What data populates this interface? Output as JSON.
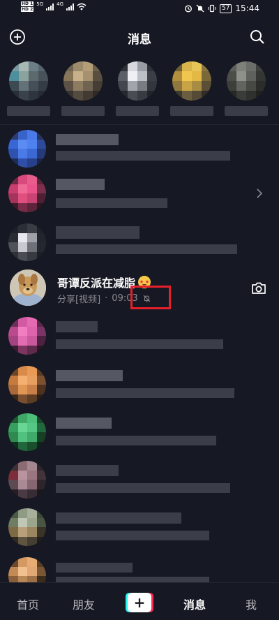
{
  "status_bar": {
    "hd1": "HD 1",
    "hd2": "HD 2",
    "net1": "5G",
    "net2": "4G",
    "battery": "57",
    "time": "15:44"
  },
  "header": {
    "title": "消息",
    "left_icon": "add-circle-icon",
    "right_icon": "search-icon"
  },
  "conversation": {
    "name": "哥谭反派在减脂",
    "emoji": "star-struck-emoji",
    "preview": "分享[视频]",
    "separator": "·",
    "time": "09:03",
    "muted_icon": "bell-muted-icon",
    "action_icon": "camera-icon"
  },
  "bottom_nav": {
    "home": "首页",
    "friends": "朋友",
    "create": "+",
    "messages": "消息",
    "me": "我"
  }
}
